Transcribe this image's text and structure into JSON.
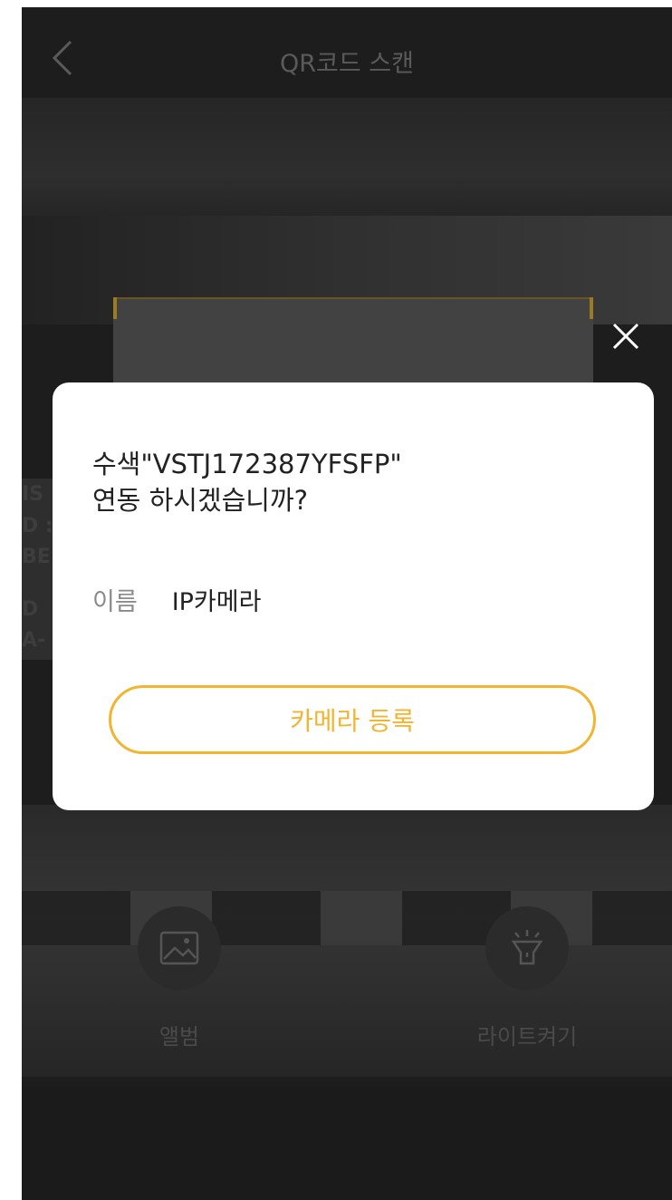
{
  "header": {
    "title": "QR코드 스캔",
    "back_icon": "chevron-left-icon"
  },
  "background_text": [
    "IS",
    "D :",
    "BE",
    "D",
    "A-"
  ],
  "dialog": {
    "message_line1": "수색\"VSTJ172387YFSFP\"",
    "message_line2": "연동 하시겠습니까?",
    "name_label": "이름",
    "name_value": "IP카메라",
    "register_button": "카메라 등록",
    "close_icon": "close-icon"
  },
  "tools": {
    "album_label": "앨범",
    "album_icon": "image-icon",
    "light_label": "라이트켜기",
    "light_icon": "flashlight-icon"
  },
  "colors": {
    "accent": "#f2b531",
    "overlay": "#1d1d1d",
    "dialog_bg": "#ffffff"
  }
}
